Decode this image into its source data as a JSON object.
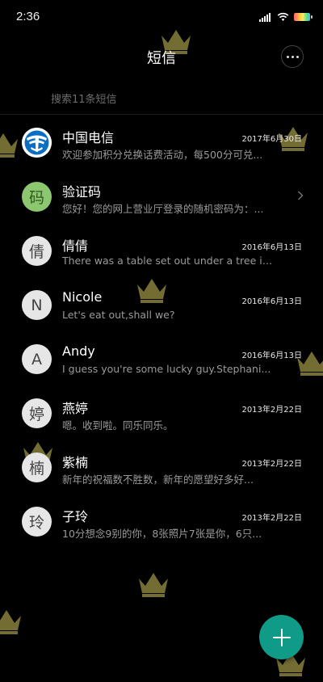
{
  "status_bar": {
    "time": "2:36",
    "icons": [
      "signal-icon",
      "wifi-icon",
      "battery-icon"
    ]
  },
  "header": {
    "title": "短信",
    "more_icon": "more-icon"
  },
  "search": {
    "placeholder": "搜索11条短信"
  },
  "conversations": [
    {
      "avatar": "telecom-logo",
      "name": "中国电信",
      "date": "2017年6月30日",
      "preview": "欢迎参加积分兑换话费活动，每500分可兑..."
    },
    {
      "avatar": "码",
      "name": "验证码",
      "date": "",
      "preview": "您好！您的网上营业厅登录的随机密码为：..."
    },
    {
      "avatar": "倩",
      "name": "倩倩",
      "date": "2016年6月13日",
      "preview": "There was a table set out under a tree in..."
    },
    {
      "avatar": "N",
      "name": "Nicole",
      "date": "2016年6月13日",
      "preview": "Let's eat out,shall we?"
    },
    {
      "avatar": "A",
      "name": "Andy",
      "date": "2016年6月13日",
      "preview": "I guess you're some lucky guy.Stephani..."
    },
    {
      "avatar": "婷",
      "name": "燕婷",
      "date": "2013年2月22日",
      "preview": "嗯。收到啦。同乐同乐。"
    },
    {
      "avatar": "楠",
      "name": "紫楠",
      "date": "2013年2月22日",
      "preview": "新年的祝福数不胜数，新年的愿望好多好..."
    },
    {
      "avatar": "玲",
      "name": "子玲",
      "date": "2013年2月22日",
      "preview": "10分想念9别的你，8张照片7张是你，6只..."
    }
  ],
  "compose": {
    "icon": "plus-icon",
    "color": "#0f9b87"
  }
}
